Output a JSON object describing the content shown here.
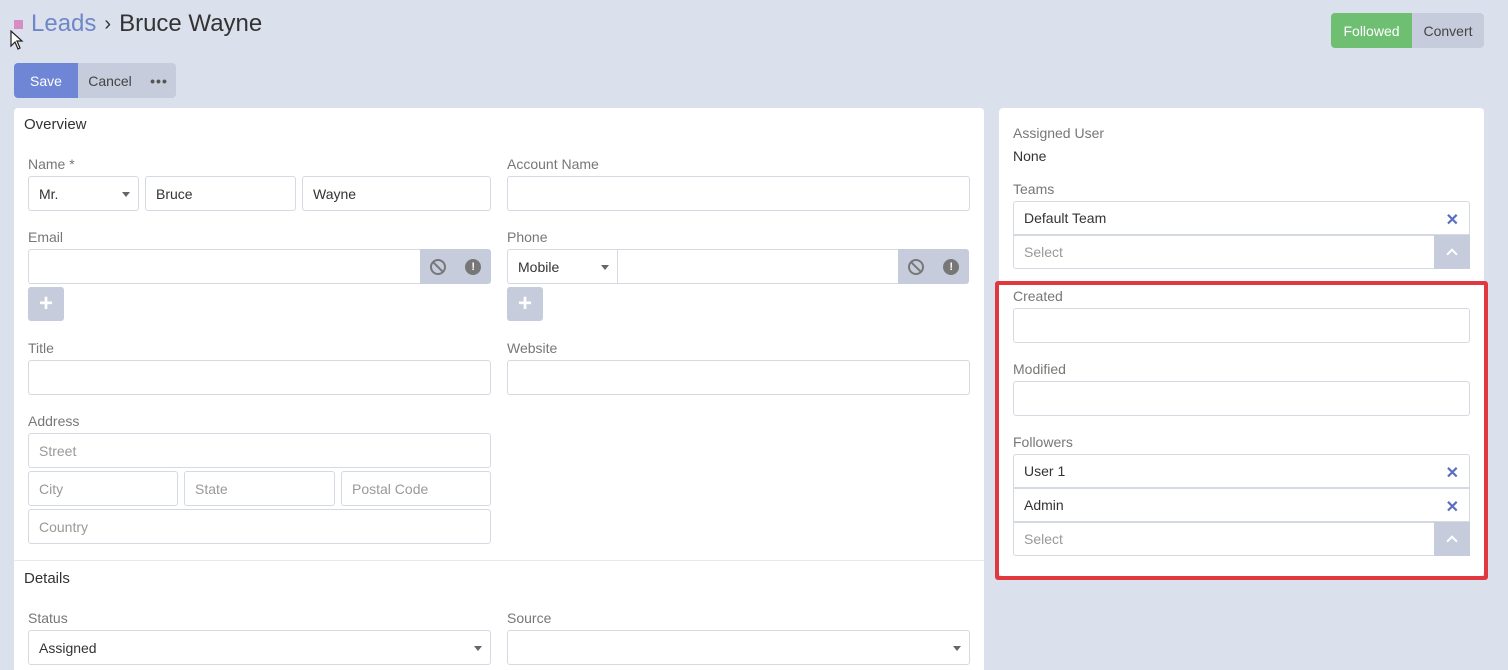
{
  "breadcrumb": {
    "parent": "Leads",
    "separator": "›",
    "current": "Bruce Wayne"
  },
  "header_buttons": {
    "followed": "Followed",
    "convert": "Convert"
  },
  "action_buttons": {
    "save": "Save",
    "cancel": "Cancel",
    "more": "•••"
  },
  "overview": {
    "heading": "Overview",
    "name": {
      "label": "Name *",
      "salutation": "Mr.",
      "first": "Bruce",
      "last": "Wayne"
    },
    "account_name": {
      "label": "Account Name",
      "value": ""
    },
    "email": {
      "label": "Email",
      "value": ""
    },
    "phone": {
      "label": "Phone",
      "type": "Mobile",
      "value": ""
    },
    "title": {
      "label": "Title",
      "value": ""
    },
    "website": {
      "label": "Website",
      "value": ""
    },
    "address": {
      "label": "Address",
      "street_placeholder": "Street",
      "city_placeholder": "City",
      "state_placeholder": "State",
      "postal_placeholder": "Postal Code",
      "country_placeholder": "Country"
    }
  },
  "details": {
    "heading": "Details",
    "status": {
      "label": "Status",
      "value": "Assigned"
    },
    "source": {
      "label": "Source",
      "value": ""
    }
  },
  "side": {
    "assigned_user": {
      "label": "Assigned User",
      "value": "None"
    },
    "teams": {
      "label": "Teams",
      "items": [
        "Default Team"
      ],
      "select_placeholder": "Select"
    },
    "created": {
      "label": "Created",
      "value": ""
    },
    "modified": {
      "label": "Modified",
      "value": ""
    },
    "followers": {
      "label": "Followers",
      "items": [
        "User 1",
        "Admin"
      ],
      "select_placeholder": "Select"
    }
  },
  "colors": {
    "accent": "#6f86d6",
    "followed": "#6fbf73",
    "highlight": "#e0383e",
    "background": "#dbe1ec"
  }
}
